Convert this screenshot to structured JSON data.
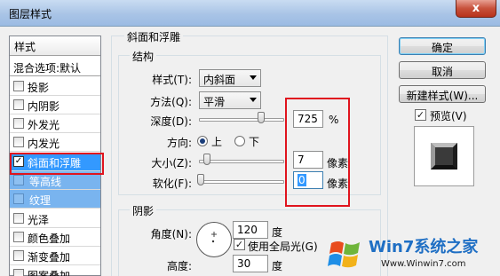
{
  "window": {
    "title": "图层样式",
    "close_label": "x"
  },
  "style_list": {
    "header": "样式",
    "blend_options": "混合选项:默认",
    "items": [
      {
        "label": "投影",
        "checked": false
      },
      {
        "label": "内阴影",
        "checked": false
      },
      {
        "label": "外发光",
        "checked": false
      },
      {
        "label": "内发光",
        "checked": false
      },
      {
        "label": "斜面和浮雕",
        "checked": true
      },
      {
        "label": "等高线",
        "checked": false
      },
      {
        "label": "纹理",
        "checked": false
      },
      {
        "label": "光泽",
        "checked": false
      },
      {
        "label": "颜色叠加",
        "checked": false
      },
      {
        "label": "渐变叠加",
        "checked": false
      },
      {
        "label": "图案叠加",
        "checked": false
      }
    ],
    "check_mark": "✓"
  },
  "bevel": {
    "group_title": "斜面和浮雕",
    "structure_title": "结构",
    "style_label": "样式(T):",
    "style_value": "内斜面",
    "method_label": "方法(Q):",
    "method_value": "平滑",
    "depth_label": "深度(D):",
    "depth_value": "725",
    "depth_unit": "%",
    "direction_label": "方向:",
    "direction_up": "上",
    "direction_down": "下",
    "size_label": "大小(Z):",
    "size_value": "7",
    "size_unit": "像素",
    "soften_label": "软化(F):",
    "soften_value": "0",
    "soften_unit": "像素"
  },
  "shading": {
    "title": "阴影",
    "angle_label": "角度(N):",
    "angle_value": "120",
    "angle_unit": "度",
    "global_light_label": "使用全局光(G)",
    "altitude_label": "高度:",
    "altitude_value": "30",
    "altitude_unit": "度"
  },
  "buttons": {
    "ok": "确定",
    "cancel": "取消",
    "new_style": "新建样式(W)...",
    "preview": "预览(V)"
  },
  "watermark": {
    "brand": "Win7系统之家",
    "url": "Www.Winwin7.com"
  }
}
